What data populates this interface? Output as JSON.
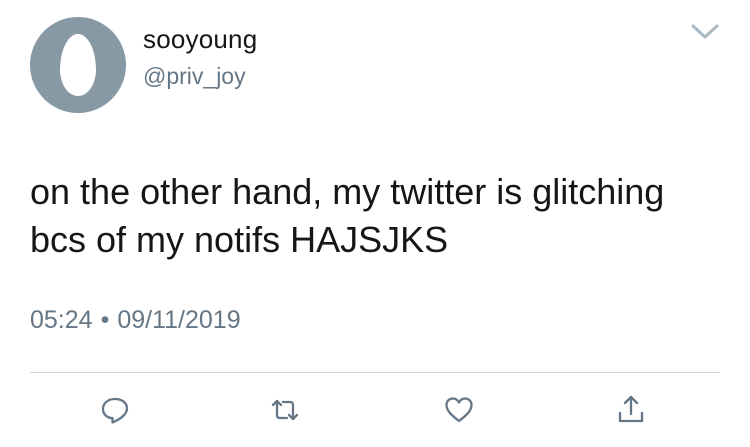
{
  "user": {
    "display_name": "sooyoung",
    "handle": "@priv_joy"
  },
  "tweet": {
    "text": "on the other hand, my twitter is glitching bcs of my notifs HAJSJKS",
    "time": "05:24",
    "separator": "•",
    "date": "09/11/2019"
  },
  "icons": {
    "avatar": "default-egg-avatar",
    "menu": "chevron-down-icon",
    "reply": "reply-icon",
    "retweet": "retweet-icon",
    "like": "heart-icon",
    "share": "share-icon"
  },
  "colors": {
    "text": "#14171a",
    "secondary": "#657786",
    "icon": "#657786",
    "avatar_bg": "#8899a6",
    "divider": "#ccd6dd",
    "chevron": "#aab8c2"
  }
}
